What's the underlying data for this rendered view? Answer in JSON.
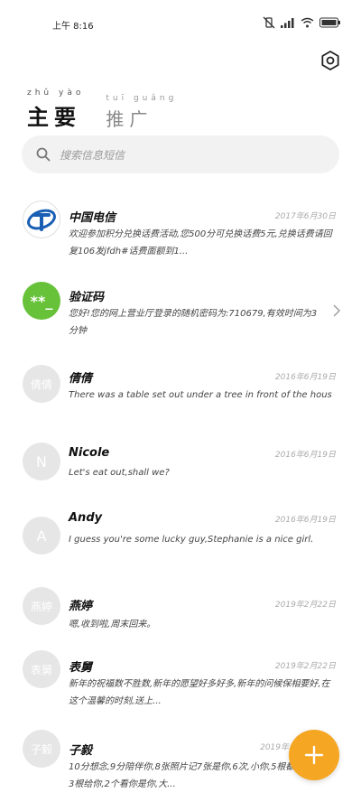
{
  "status": {
    "time": "上午 8:16"
  },
  "tabs": [
    {
      "pinyin": "zhǔ yào",
      "label": "主要"
    },
    {
      "pinyin": "tuī guǎng",
      "label": "推广"
    }
  ],
  "search": {
    "placeholder": "搜索信息短信"
  },
  "colors": {
    "accent": "#f5a623",
    "verify_green": "#67c23a",
    "telecom_blue": "#1a5fb4"
  },
  "messages": [
    {
      "name": "中国电信",
      "date": "2017年6月30日",
      "preview": "欢迎参加积分兑换话费活动,您500分可兑换话费5元,兑换话费请回复106发jfdh#话费面额到1..."
    },
    {
      "name": "验证码",
      "date": "",
      "preview": "您好!您的网上营业厅登录的随机密码为:710679,有效时间为3分钟"
    },
    {
      "name": "倩倩",
      "avatar_text": "倩倩",
      "date": "2016年6月19日",
      "preview": "There was a table set out under a tree in front of the hous"
    },
    {
      "name": "Nicole",
      "avatar_text": "N",
      "date": "2016年6月19日",
      "preview": "Let's eat out,shall we?"
    },
    {
      "name": "Andy",
      "avatar_text": "A",
      "date": "2016年6月19日",
      "preview": "I guess you're some lucky guy,Stephanie is a nice girl."
    },
    {
      "name": "燕婷",
      "avatar_text": "燕婷",
      "date": "2019年2月22日",
      "preview": "嗯,收到啦,周末回来。"
    },
    {
      "name": "表舅",
      "avatar_text": "表舅",
      "date": "2019年2月22日",
      "preview": "新年的祝福数不胜数,新年的愿望好多好多,新年的问候保相要好,在这个温馨的时刻,送上..."
    },
    {
      "name": "子毅",
      "avatar_text": "子毅",
      "date": "2019年",
      "preview": "10分想念,9分陪伴你,8张照片记7张是你,6次,小你,5根都买3根给你,2个看你是你,大..."
    }
  ],
  "icons": {
    "settings": "gear-icon",
    "search": "search-icon",
    "fab": "plus-icon",
    "chevron": "chevron-right-icon"
  }
}
